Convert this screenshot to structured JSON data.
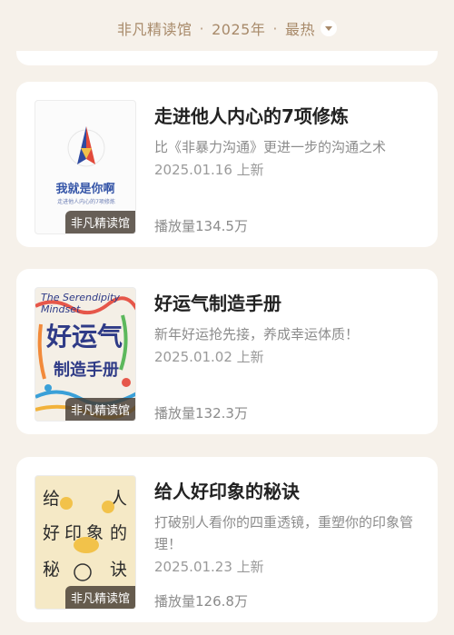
{
  "header": {
    "channel": "非凡精读馆",
    "year": "2025年",
    "sort": "最热"
  },
  "items": [
    {
      "title": "走进他人内心的7项修炼",
      "desc": "比《非暴力沟通》更进一步的沟通之术",
      "date": "2025.01.16 上新",
      "plays": "播放量134.5万",
      "brand": "非凡精读馆",
      "cover_title": "我就是你啊",
      "cover_sub": "走进他人内心的7项修炼"
    },
    {
      "title": "好运气制造手册",
      "desc": "新年好运抢先接，养成幸运体质！",
      "date": "2025.01.02 上新",
      "plays": "播放量132.3万",
      "brand": "非凡精读馆",
      "cover_top": "The Serendipity Mindset",
      "cover_big": "好运气",
      "cover_small": "制造手册"
    },
    {
      "title": "给人好印象的秘诀",
      "desc": "打破别人看你的四重透镜，重塑你的印象管理！",
      "date": "2025.01.23 上新",
      "plays": "播放量126.8万",
      "brand": "非凡精读馆",
      "cover_chars": [
        "给",
        "人",
        "好",
        "印",
        "象",
        "的",
        "秘",
        "诀"
      ]
    }
  ],
  "colors": {
    "background": "#f6f1ea",
    "header_text": "#a88a6a",
    "card": "#ffffff"
  }
}
